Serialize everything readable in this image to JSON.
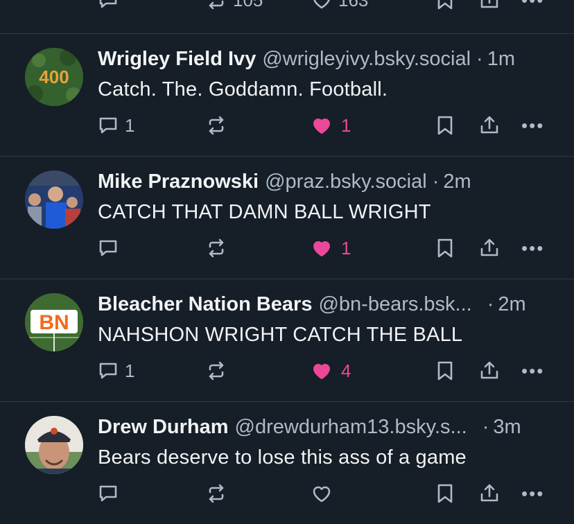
{
  "top_partial": {
    "repost_count": "105",
    "like_count": "163"
  },
  "posts": [
    {
      "display_name": "Wrigley Field Ivy",
      "handle": "@wrigleyivy.bsky.social",
      "time": "1m",
      "text": "Catch. The. Goddamn. Football.",
      "reply_count": "1",
      "like_count": "1",
      "liked": true,
      "avatar": {
        "label": "400",
        "bg": "#2f5a2a",
        "fg": "#e9a23b"
      }
    },
    {
      "display_name": "Mike Praznowski",
      "handle": "@praz.bsky.social",
      "time": "2m",
      "text": "CATCH THAT DAMN BALL WRIGHT",
      "reply_count": "",
      "like_count": "1",
      "liked": true,
      "avatar": {
        "bg": "#1e4fa3"
      }
    },
    {
      "display_name": "Bleacher Nation Bears",
      "handle": "@bn-bears.bsk...",
      "time": "2m",
      "text": "NAHSHON WRIGHT CATCH THE BALL",
      "reply_count": "1",
      "like_count": "4",
      "liked": true,
      "avatar": {
        "label": "BN",
        "bg": "#3e6b32",
        "fg": "#f26a1b"
      }
    },
    {
      "display_name": "Drew Durham",
      "handle": "@drewdurham13.bsky.s...",
      "time": "3m",
      "text": "Bears deserve to lose this ass of a game",
      "reply_count": "",
      "like_count": "",
      "liked": false,
      "avatar": {
        "bg": "#c9b79a"
      }
    }
  ],
  "colors": {
    "background": "#161e27",
    "muted": "#aebbc9",
    "like": "#ec4899",
    "divider": "#2e3a47"
  },
  "icons": [
    "reply-icon",
    "repost-icon",
    "like-icon",
    "bookmark-icon",
    "share-icon",
    "more-icon"
  ]
}
